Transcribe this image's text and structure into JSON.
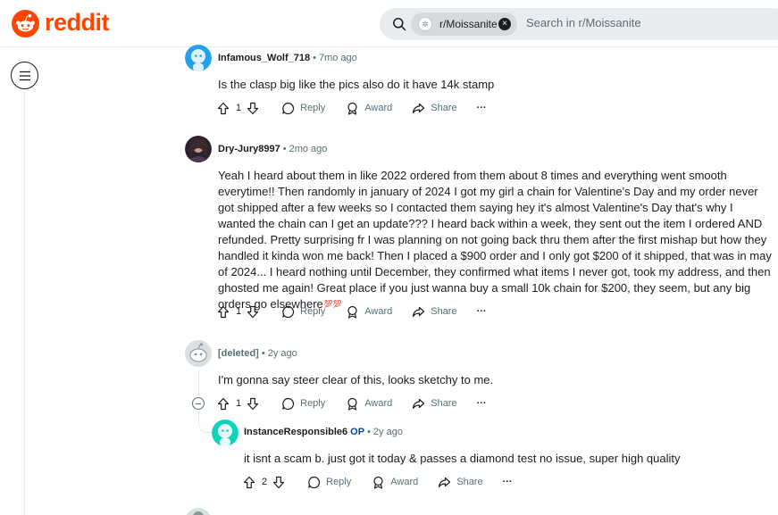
{
  "header": {
    "logo_text": "reddit",
    "brand_color": "#ff4500",
    "search": {
      "chip_label": "r/Moissanite",
      "placeholder": "Search in r/Moissanite"
    }
  },
  "comments": [
    {
      "author": "Infamous_Wolf_718",
      "time": "7mo ago",
      "body": "Is the clasp big like the pics also do it have 14k stamp",
      "score": "1",
      "reply_label": "Reply",
      "award_label": "Award",
      "share_label": "Share",
      "more_label": "···"
    },
    {
      "author": "Dry-Jury8997",
      "time": "2mo ago",
      "body": "Yeah I heard about them in like 2022 ordered from them about 8 times and everything went smooth everytime!! Then randomly in january of 2024 I got my girl a chain for Valentine's Day and my order never got shipped after a few weeks so I contacted them saying hey it's almost Valentine's Day that's why I wanted the chain can I get an update??? I heard back within a week, they sent out the item I ordered AND refunded. Pretty surprising fr I was planning on not going back thru them after the first mishap but how they handled it kinda won me back! Then I placed a $900 order and I only got $200 of it shipped, that was in may of 2024... I heard nothing until December, they confirmed what items I never got, took my address, and then ghosted me again! Great place if you just wanna buy a small 10k chain for $200, they seem, but any big orders go elsewhere",
      "inline_awards": "💯💯",
      "score": "1",
      "reply_label": "Reply",
      "award_label": "Award",
      "share_label": "Share",
      "more_label": "···"
    },
    {
      "author": "[deleted]",
      "time": "2y ago",
      "body": "I'm gonna say steer clear of this, looks sketchy to me.",
      "score": "1",
      "reply_label": "Reply",
      "award_label": "Award",
      "share_label": "Share",
      "more_label": "···"
    },
    {
      "author": "InstanceResponsible6",
      "op_badge": "OP",
      "time": "2y ago",
      "body": "it isnt a scam b. just got it today & passes a diamond test no issue, super high quality",
      "score": "2",
      "reply_label": "Reply",
      "award_label": "Award",
      "share_label": "Share",
      "more_label": "···"
    }
  ],
  "colors": {
    "meta_text": "#576f76",
    "op_badge": "#0a449b",
    "thread_line": "#e5ebee",
    "avatar_teal": "#46d160"
  }
}
